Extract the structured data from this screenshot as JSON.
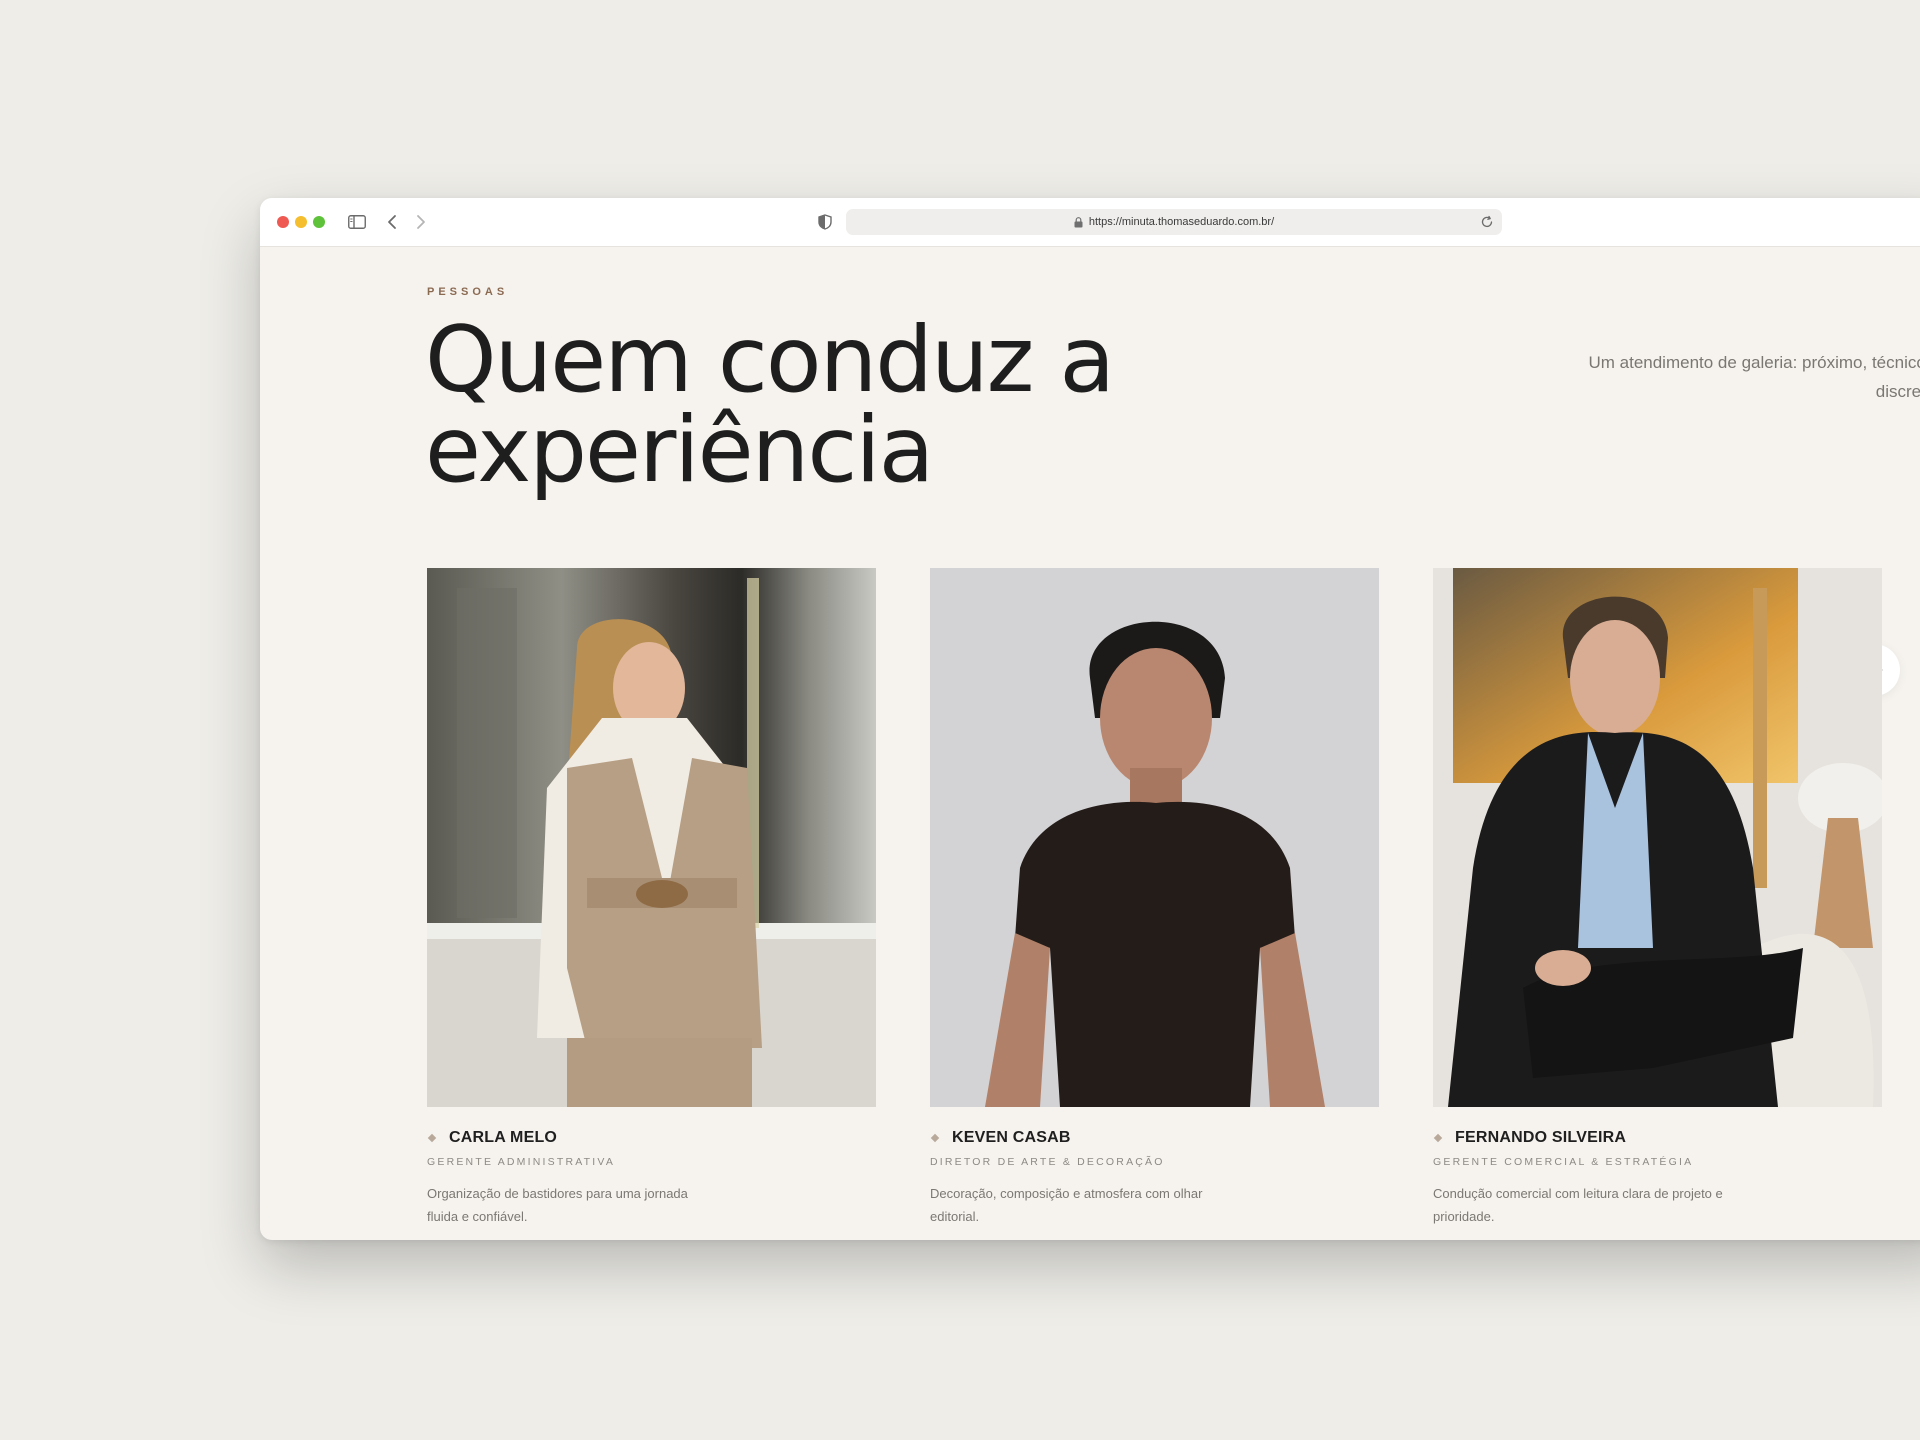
{
  "browser": {
    "url": "https://minuta.thomaseduardo.com.br/"
  },
  "section": {
    "eyebrow": "PESSOAS",
    "title_line1": "Quem conduz a",
    "title_line2": "experiência",
    "tagline": "Um atendimento de galeria: próximo, técnico e discreto."
  },
  "team": [
    {
      "name": "CARLA MELO",
      "role": "GERENTE ADMINISTRATIVA",
      "description": "Organização de bastidores para uma jornada fluida e confiável."
    },
    {
      "name": "KEVEN CASAB",
      "role": "DIRETOR DE ARTE & DECORAÇÃO",
      "description": "Decoração, composição e atmosfera com olhar editorial."
    },
    {
      "name": "FERNANDO SILVEIRA",
      "role": "GERENTE COMERCIAL & ESTRATÉGIA",
      "description": "Condução comercial com leitura clara de projeto e prioridade."
    }
  ],
  "icons": {
    "prev": "arrow-left-icon",
    "next": "arrow-right-icon"
  }
}
